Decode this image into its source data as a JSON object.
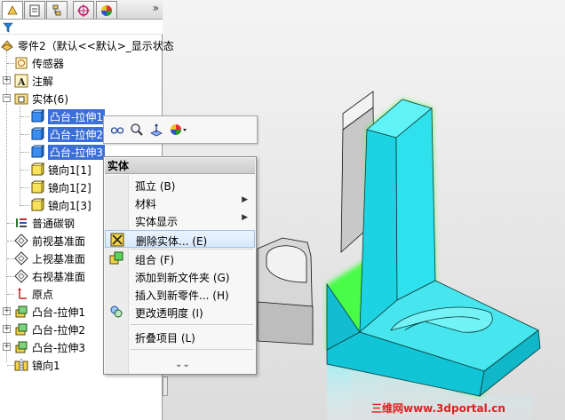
{
  "tabs": [
    {
      "name": "feature-manager-tab-icon",
      "active": true
    },
    {
      "name": "property-manager-tab-icon",
      "active": false
    },
    {
      "name": "configuration-manager-tab-icon",
      "active": false
    },
    {
      "name": "dimxpert-tab-icon",
      "active": false
    },
    {
      "name": "display-manager-tab-icon",
      "active": false
    }
  ],
  "tabs_more": "»",
  "tree": {
    "root": "零件2（默认<<默认>_显示状态",
    "sensors": "传感器",
    "annotations": "注解",
    "solid_bodies": "实体(6)",
    "bodies": [
      {
        "label": "凸台-拉伸1",
        "selected": true
      },
      {
        "label": "凸台-拉伸2",
        "selected": true
      },
      {
        "label": "凸台-拉伸3",
        "selected": true
      },
      {
        "label": "镜向1[1]",
        "selected": false
      },
      {
        "label": "镜向1[2]",
        "selected": false
      },
      {
        "label": "镜向1[3]",
        "selected": false
      }
    ],
    "material": "普通碳钢",
    "front_plane": "前视基准面",
    "top_plane": "上视基准面",
    "right_plane": "右视基准面",
    "origin": "原点",
    "features": [
      "凸台-拉伸1",
      "凸台-拉伸2",
      "凸台-拉伸3"
    ],
    "mirror": "镜向1"
  },
  "context_menu": {
    "header": "实体",
    "items": [
      {
        "label": "孤立 (B)",
        "submenu": false
      },
      {
        "label": "材料",
        "submenu": true
      },
      {
        "label": "实体显示",
        "submenu": true
      },
      {
        "label": "删除实体... (E)",
        "submenu": false
      },
      {
        "label": "组合 (F)",
        "submenu": false
      },
      {
        "label": "添加到新文件夹 (G)",
        "submenu": false
      },
      {
        "label": "插入到新零件... (H)",
        "submenu": false
      },
      {
        "label": "更改透明度 (I)",
        "submenu": false
      },
      {
        "label": "折叠项目 (L)",
        "submenu": false
      }
    ],
    "more": "⌄⌄"
  },
  "watermark": "三维网www.3dportal.cn",
  "colors": {
    "selection": "#3a6fd8",
    "highlight_cyan": "#29d6e6",
    "highlight_edge": "#2aff2a",
    "body_gray": "#e6e6e6",
    "body_yellow": "#f7e25a"
  }
}
